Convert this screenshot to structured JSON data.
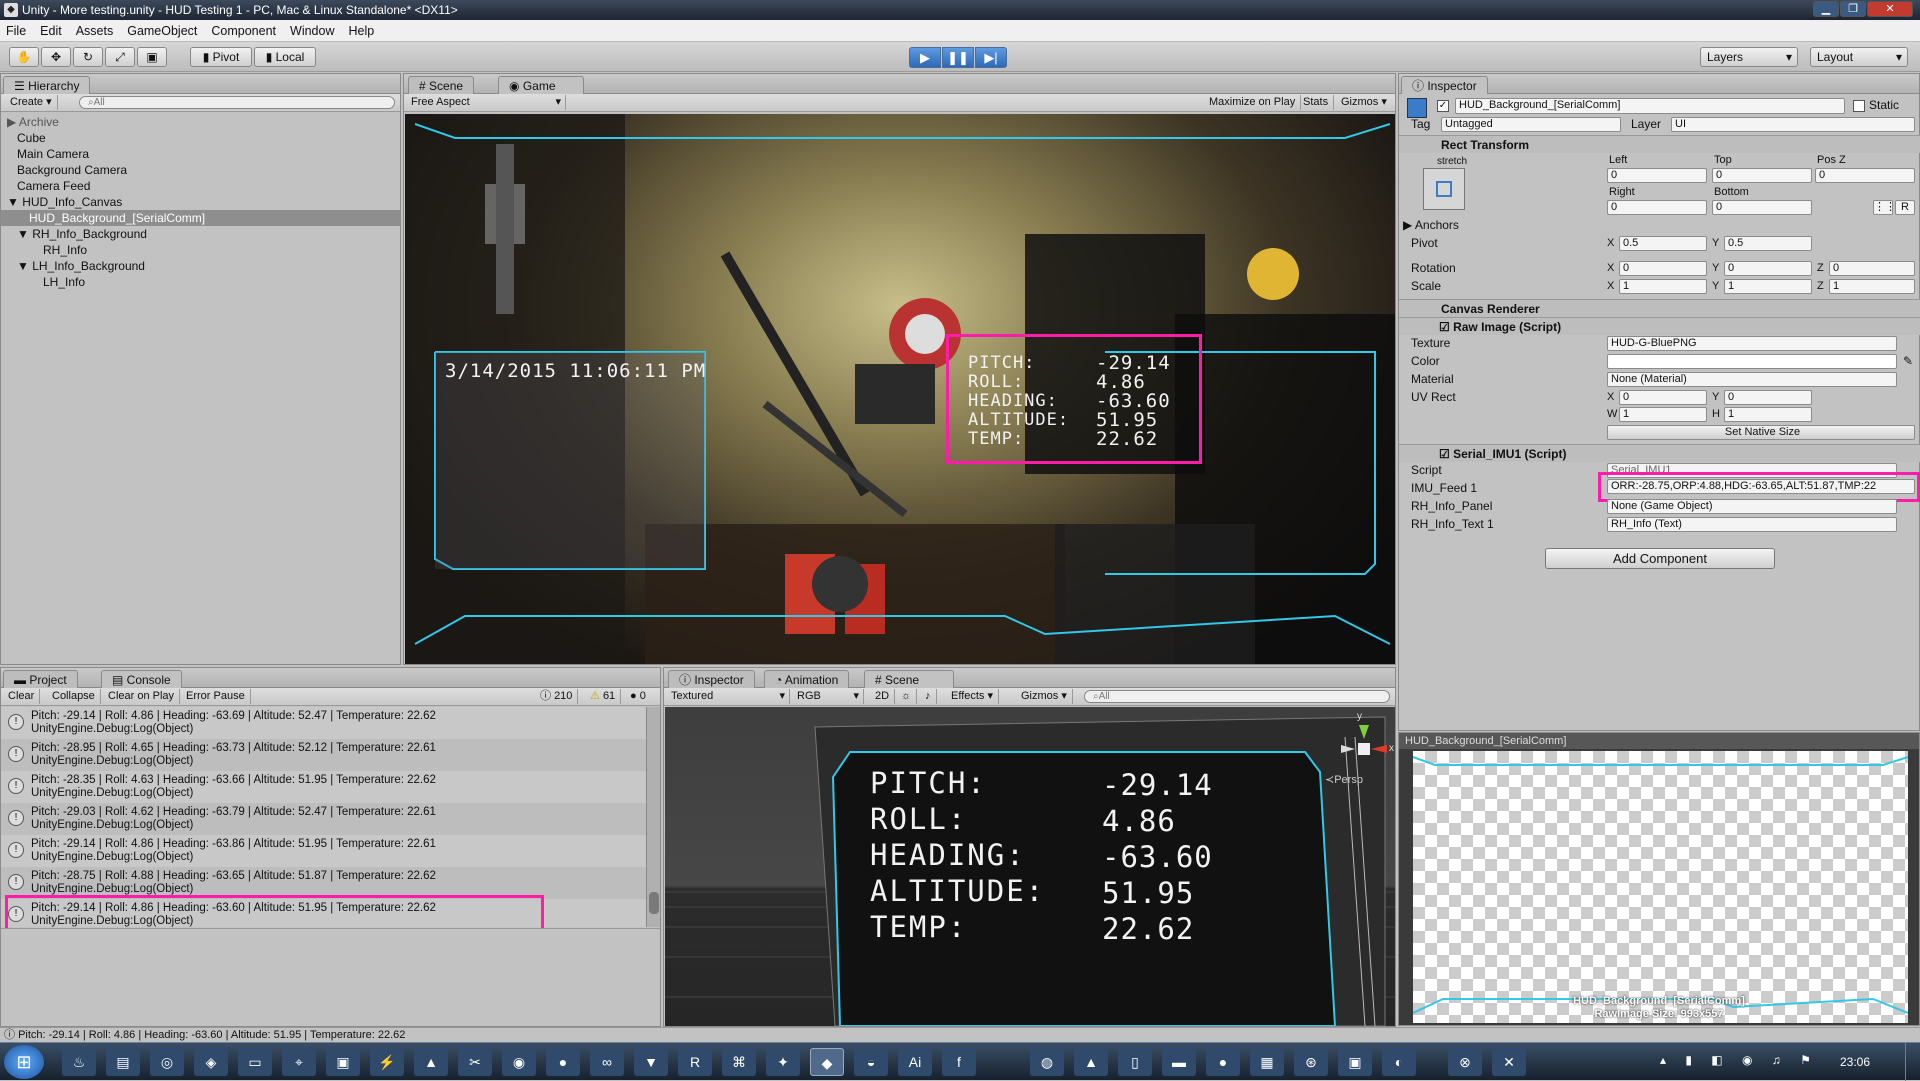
{
  "window": {
    "title": "Unity - More testing.unity - HUD Testing 1 - PC, Mac & Linux Standalone* <DX11>"
  },
  "menu": [
    "File",
    "Edit",
    "Assets",
    "GameObject",
    "Component",
    "Window",
    "Help"
  ],
  "toolbar": {
    "pivot_label": "Pivot",
    "local_label": "Local",
    "layers_label": "Layers",
    "layout_label": "Layout"
  },
  "hierarchy": {
    "tab_label": "Hierarchy",
    "create_label": "Create",
    "search_placeholder": "All",
    "items": [
      "Archive",
      "Cube",
      "Main Camera",
      "Background Camera",
      "Camera Feed",
      "HUD_Info_Canvas",
      "HUD_Background_[SerialComm]",
      "RH_Info_Background",
      "RH_Info",
      "LH_Info_Background",
      "LH_Info"
    ]
  },
  "game_view": {
    "tabs": [
      "Scene",
      "Game"
    ],
    "aspect": "Free Aspect",
    "maximize": "Maximize on Play",
    "stats": "Stats",
    "gizmos": "Gizmos",
    "datetime": "3/14/2015 11:06:11 PM",
    "hud_labels": [
      "PITCH:",
      "ROLL:",
      "HEADING:",
      "ALTITUDE:",
      "TEMP:"
    ],
    "hud_values": [
      "-29.14",
      "4.86",
      "-63.60",
      "51.95",
      "22.62"
    ]
  },
  "inspector": {
    "tab_label": "Inspector",
    "object_name": "HUD_Background_[SerialComm]",
    "static_label": "Static",
    "tag_label": "Tag",
    "tag_value": "Untagged",
    "layer_label": "Layer",
    "layer_value": "UI",
    "rect_transform": {
      "title": "Rect Transform",
      "stretch": "stretch",
      "left_label": "Left",
      "top_label": "Top",
      "posz_label": "Pos Z",
      "left": "0",
      "top": "0",
      "posz": "0",
      "right_label": "Right",
      "bottom_label": "Bottom",
      "right": "0",
      "bottom": "0",
      "anchors_label": "Anchors",
      "pivot_label": "Pivot",
      "pivot_x": "0.5",
      "pivot_y": "0.5",
      "rotation_label": "Rotation",
      "rot_x": "0",
      "rot_y": "0",
      "rot_z": "0",
      "scale_label": "Scale",
      "scale_x": "1",
      "scale_y": "1",
      "scale_z": "1",
      "r_label": "R"
    },
    "canvas_renderer": "Canvas Renderer",
    "raw_image": {
      "title": "Raw Image (Script)",
      "texture_label": "Texture",
      "texture": "HUD-G-BluePNG",
      "color_label": "Color",
      "material_label": "Material",
      "material": "None (Material)",
      "uvrect_label": "UV Rect",
      "uv_x": "0",
      "uv_y": "0",
      "uv_w": "1",
      "uv_h": "1",
      "set_native": "Set Native Size"
    },
    "serial": {
      "title": "Serial_IMU1 (Script)",
      "script_label": "Script",
      "script": "Serial_IMU1",
      "feed_label": "IMU_Feed 1",
      "feed": "ORR:-28.75,ORP:4.88,HDG:-63.65,ALT:51.87,TMP:22",
      "panel_label": "RH_Info_Panel",
      "panel": "None (Game Object)",
      "text_label": "RH_Info_Text 1",
      "text": "RH_Info (Text)"
    },
    "add_component": "Add Component",
    "preview_title": "HUD_Background_[SerialComm]",
    "preview_caption_1": "HUD_Background_[SerialComm]",
    "preview_caption_2": "RawImage Size: 993x557"
  },
  "console": {
    "tabs": [
      "Project",
      "Console"
    ],
    "buttons": [
      "Clear",
      "Collapse",
      "Clear on Play",
      "Error Pause"
    ],
    "info_count": "210",
    "warn_count": "61",
    "error_count": "0",
    "logs": [
      {
        "line1": "Pitch: -29.14 | Roll: 4.86 | Heading: -63.69 | Altitude: 52.47 | Temperature: 22.62",
        "line2": "UnityEngine.Debug:Log(Object)"
      },
      {
        "line1": "Pitch: -28.95 | Roll: 4.65 | Heading: -63.73 | Altitude: 52.12 | Temperature: 22.61",
        "line2": "UnityEngine.Debug:Log(Object)"
      },
      {
        "line1": "Pitch: -28.35 | Roll: 4.63 | Heading: -63.66 | Altitude: 51.95 | Temperature: 22.62",
        "line2": "UnityEngine.Debug:Log(Object)"
      },
      {
        "line1": "Pitch: -29.03 | Roll: 4.62 | Heading: -63.79 | Altitude: 52.47 | Temperature: 22.61",
        "line2": "UnityEngine.Debug:Log(Object)"
      },
      {
        "line1": "Pitch: -29.14 | Roll: 4.86 | Heading: -63.86 | Altitude: 51.95 | Temperature: 22.61",
        "line2": "UnityEngine.Debug:Log(Object)"
      },
      {
        "line1": "Pitch: -28.75 | Roll: 4.88 | Heading: -63.65 | Altitude: 51.87 | Temperature: 22.62",
        "line2": "UnityEngine.Debug:Log(Object)"
      },
      {
        "line1": "Pitch: -29.14 | Roll: 4.86 | Heading: -63.60 | Altitude: 51.95 | Temperature: 22.62",
        "line2": "UnityEngine.Debug:Log(Object)"
      }
    ]
  },
  "scene_view": {
    "tabs": [
      "Inspector",
      "Animation",
      "Scene"
    ],
    "shading": "Textured",
    "rgb": "RGB",
    "twod": "2D",
    "effects": "Effects",
    "gizmos": "Gizmos",
    "search_placeholder": "All",
    "persp": "Persp",
    "axis_y": "y",
    "axis_x": "x",
    "labels": [
      "PITCH:",
      "ROLL:",
      "HEADING:",
      "ALTITUDE:",
      "TEMP:"
    ],
    "values": [
      "-29.14",
      "4.86",
      "-63.60",
      "51.95",
      "22.62"
    ]
  },
  "status_bar": "Pitch: -29.14 | Roll: 4.86 | Heading: -63.60 | Altitude: 51.95 | Temperature: 22.62",
  "clock": "23:06",
  "colors": {
    "highlight": "#ff1ca8",
    "hud_cyan": "#33c7e8",
    "play_blue": "#3c78c8"
  }
}
